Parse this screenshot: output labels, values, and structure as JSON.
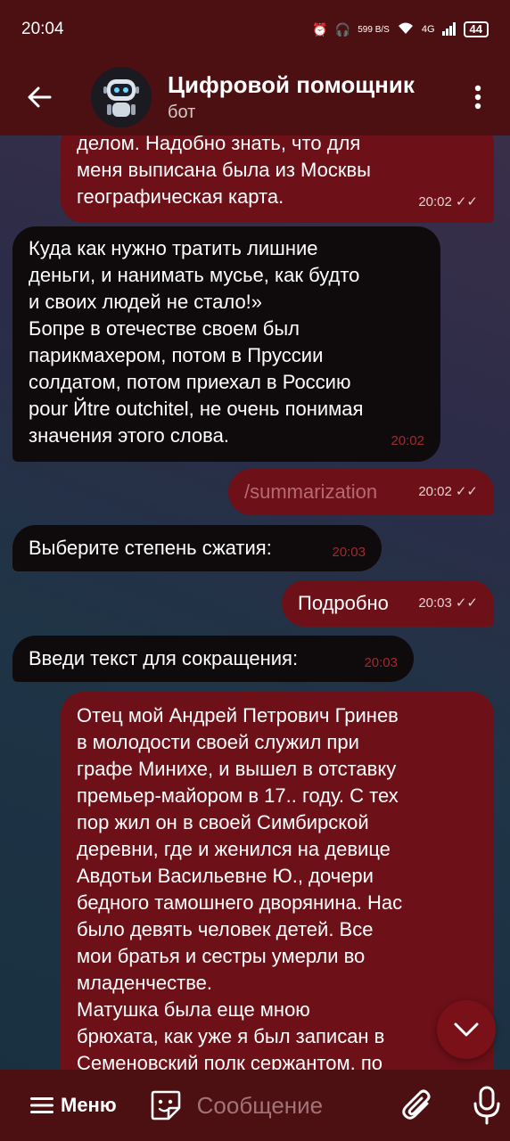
{
  "status_bar": {
    "time": "20:04",
    "net_speed": "599 B/S",
    "network": "4G",
    "battery": "44"
  },
  "header": {
    "title": "Цифровой помощник",
    "subtitle": "бот"
  },
  "messages": [
    {
      "dir": "out",
      "text": "делом. Надобно знать, что для\nменя выписана была из Москвы\nгеографическая карта.",
      "time": "20:02",
      "read": "✓✓"
    },
    {
      "dir": "in",
      "text": "Куда как нужно тратить лишние\nденьги, и нанимать мусье, как будто\nи своих людей не стало!»\nБопре в отечестве своем был\nпарикмахером, потом в Пруссии\nсолдатом, потом приехал в Россию\npour Йtre outchitel, не очень понимая\nзначения этого слова.",
      "time": "20:02"
    },
    {
      "dir": "out",
      "text": "/summarization",
      "time": "20:02",
      "read": "✓✓"
    },
    {
      "dir": "in",
      "text": "Выберите степень сжатия:",
      "time": "20:03"
    },
    {
      "dir": "out",
      "text": "Подробно",
      "time": "20:03",
      "read": "✓✓"
    },
    {
      "dir": "in",
      "text": "Введи текст для сокращения:",
      "time": "20:03"
    },
    {
      "dir": "out",
      "text": "Отец мой Андрей Петрович Гринев\nв молодости своей служил при\nграфе Минихе, и вышел в отставку\nпремьер-майором в 17.. году. С тех\nпор жил он в своей Симбирской\nдеревни, где и женился на девице\nАвдотьи Васильевне Ю., дочери\nбедного тамошнего дворянина. Нас\nбыло девять человек детей. Все\nмои братья и сестры умерли во\nмладенчестве.\nМатушка была еще мною\nбрюхата, как уже я был записан в\nСеменовский полк сержантом, по"
    }
  ],
  "composer": {
    "menu_label": "Меню",
    "placeholder": "Сообщение"
  },
  "icons": {
    "back": "arrow-left-icon",
    "more": "more-vertical-icon",
    "scroll": "chevron-down-icon",
    "emoji": "sticker-icon",
    "attach": "paperclip-icon",
    "mic": "microphone-icon"
  },
  "colors": {
    "bar": "#4c0f12",
    "outgoing": "#6e1018",
    "incoming": "#0f0b0c"
  }
}
